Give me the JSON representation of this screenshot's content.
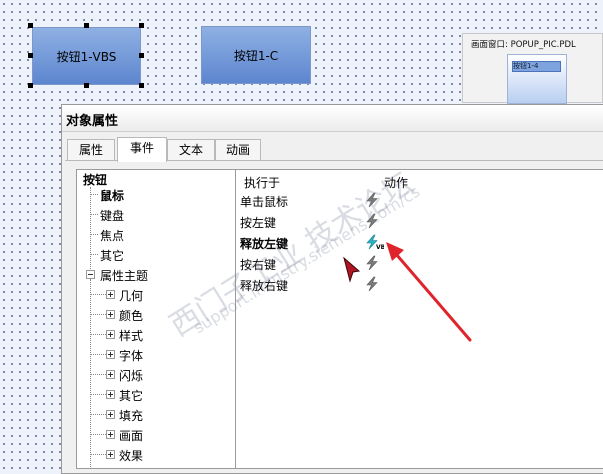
{
  "canvas": {
    "button_vbs_label": "按钮1-VBS",
    "button_c_label": "按钮1-C",
    "popup": {
      "title": "画面窗口: POPUP_PIC.PDL",
      "mini_label": "按钮1-4"
    }
  },
  "dialog": {
    "title": "对象属性",
    "tabs": [
      {
        "label": "属性"
      },
      {
        "label": "事件"
      },
      {
        "label": "文本"
      },
      {
        "label": "动画"
      }
    ],
    "active_tab": "事件",
    "tree": {
      "root": "按钮",
      "children": [
        {
          "label": "鼠标"
        },
        {
          "label": "键盘"
        },
        {
          "label": "焦点"
        },
        {
          "label": "其它"
        }
      ],
      "theme_label": "属性主题",
      "theme_children": [
        {
          "label": "几何"
        },
        {
          "label": "颜色"
        },
        {
          "label": "样式"
        },
        {
          "label": "字体"
        },
        {
          "label": "闪烁"
        },
        {
          "label": "其它"
        },
        {
          "label": "填充"
        },
        {
          "label": "画面"
        },
        {
          "label": "效果"
        }
      ]
    },
    "action_table": {
      "headers": {
        "trigger": "执行于",
        "action": "动作"
      },
      "rows": [
        {
          "trigger": "单击鼠标",
          "icon": "lightning-icon"
        },
        {
          "trigger": "按左键",
          "icon": "lightning-icon"
        },
        {
          "trigger": "释放左键",
          "icon": "lightning-vb-icon"
        },
        {
          "trigger": "按右键",
          "icon": "lightning-icon"
        },
        {
          "trigger": "释放右键",
          "icon": "lightning-icon"
        }
      ],
      "vb_badge": "VB"
    }
  },
  "watermark": {
    "line1": "西门子工业 技术论坛",
    "line2": "support.industry.siemens.com/cs"
  },
  "colors": {
    "accent_arrow": "#e0242c",
    "button_fill": "#6f95d6",
    "vb_bolt": "#2bb3c7"
  }
}
